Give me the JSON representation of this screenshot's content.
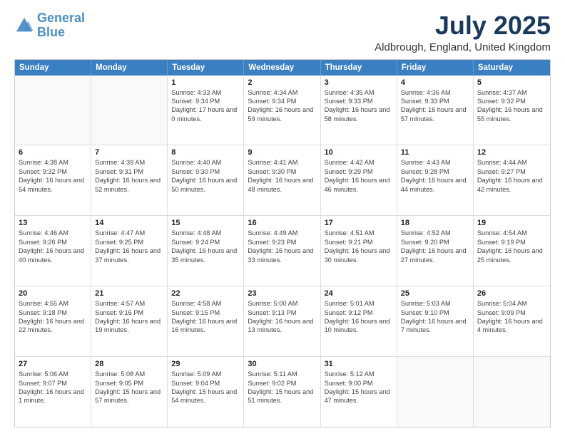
{
  "logo": {
    "line1": "General",
    "line2": "Blue"
  },
  "title": "July 2025",
  "subtitle": "Aldbrough, England, United Kingdom",
  "days_of_week": [
    "Sunday",
    "Monday",
    "Tuesday",
    "Wednesday",
    "Thursday",
    "Friday",
    "Saturday"
  ],
  "weeks": [
    [
      {
        "day": "",
        "sunrise": "",
        "sunset": "",
        "daylight": ""
      },
      {
        "day": "",
        "sunrise": "",
        "sunset": "",
        "daylight": ""
      },
      {
        "day": "1",
        "sunrise": "Sunrise: 4:33 AM",
        "sunset": "Sunset: 9:34 PM",
        "daylight": "Daylight: 17 hours and 0 minutes."
      },
      {
        "day": "2",
        "sunrise": "Sunrise: 4:34 AM",
        "sunset": "Sunset: 9:34 PM",
        "daylight": "Daylight: 16 hours and 59 minutes."
      },
      {
        "day": "3",
        "sunrise": "Sunrise: 4:35 AM",
        "sunset": "Sunset: 9:33 PM",
        "daylight": "Daylight: 16 hours and 58 minutes."
      },
      {
        "day": "4",
        "sunrise": "Sunrise: 4:36 AM",
        "sunset": "Sunset: 9:33 PM",
        "daylight": "Daylight: 16 hours and 57 minutes."
      },
      {
        "day": "5",
        "sunrise": "Sunrise: 4:37 AM",
        "sunset": "Sunset: 9:32 PM",
        "daylight": "Daylight: 16 hours and 55 minutes."
      }
    ],
    [
      {
        "day": "6",
        "sunrise": "Sunrise: 4:38 AM",
        "sunset": "Sunset: 9:32 PM",
        "daylight": "Daylight: 16 hours and 54 minutes."
      },
      {
        "day": "7",
        "sunrise": "Sunrise: 4:39 AM",
        "sunset": "Sunset: 9:31 PM",
        "daylight": "Daylight: 16 hours and 52 minutes."
      },
      {
        "day": "8",
        "sunrise": "Sunrise: 4:40 AM",
        "sunset": "Sunset: 9:30 PM",
        "daylight": "Daylight: 16 hours and 50 minutes."
      },
      {
        "day": "9",
        "sunrise": "Sunrise: 4:41 AM",
        "sunset": "Sunset: 9:30 PM",
        "daylight": "Daylight: 16 hours and 48 minutes."
      },
      {
        "day": "10",
        "sunrise": "Sunrise: 4:42 AM",
        "sunset": "Sunset: 9:29 PM",
        "daylight": "Daylight: 16 hours and 46 minutes."
      },
      {
        "day": "11",
        "sunrise": "Sunrise: 4:43 AM",
        "sunset": "Sunset: 9:28 PM",
        "daylight": "Daylight: 16 hours and 44 minutes."
      },
      {
        "day": "12",
        "sunrise": "Sunrise: 4:44 AM",
        "sunset": "Sunset: 9:27 PM",
        "daylight": "Daylight: 16 hours and 42 minutes."
      }
    ],
    [
      {
        "day": "13",
        "sunrise": "Sunrise: 4:46 AM",
        "sunset": "Sunset: 9:26 PM",
        "daylight": "Daylight: 16 hours and 40 minutes."
      },
      {
        "day": "14",
        "sunrise": "Sunrise: 4:47 AM",
        "sunset": "Sunset: 9:25 PM",
        "daylight": "Daylight: 16 hours and 37 minutes."
      },
      {
        "day": "15",
        "sunrise": "Sunrise: 4:48 AM",
        "sunset": "Sunset: 9:24 PM",
        "daylight": "Daylight: 16 hours and 35 minutes."
      },
      {
        "day": "16",
        "sunrise": "Sunrise: 4:49 AM",
        "sunset": "Sunset: 9:23 PM",
        "daylight": "Daylight: 16 hours and 33 minutes."
      },
      {
        "day": "17",
        "sunrise": "Sunrise: 4:51 AM",
        "sunset": "Sunset: 9:21 PM",
        "daylight": "Daylight: 16 hours and 30 minutes."
      },
      {
        "day": "18",
        "sunrise": "Sunrise: 4:52 AM",
        "sunset": "Sunset: 9:20 PM",
        "daylight": "Daylight: 16 hours and 27 minutes."
      },
      {
        "day": "19",
        "sunrise": "Sunrise: 4:54 AM",
        "sunset": "Sunset: 9:19 PM",
        "daylight": "Daylight: 16 hours and 25 minutes."
      }
    ],
    [
      {
        "day": "20",
        "sunrise": "Sunrise: 4:55 AM",
        "sunset": "Sunset: 9:18 PM",
        "daylight": "Daylight: 16 hours and 22 minutes."
      },
      {
        "day": "21",
        "sunrise": "Sunrise: 4:57 AM",
        "sunset": "Sunset: 9:16 PM",
        "daylight": "Daylight: 16 hours and 19 minutes."
      },
      {
        "day": "22",
        "sunrise": "Sunrise: 4:58 AM",
        "sunset": "Sunset: 9:15 PM",
        "daylight": "Daylight: 16 hours and 16 minutes."
      },
      {
        "day": "23",
        "sunrise": "Sunrise: 5:00 AM",
        "sunset": "Sunset: 9:13 PM",
        "daylight": "Daylight: 16 hours and 13 minutes."
      },
      {
        "day": "24",
        "sunrise": "Sunrise: 5:01 AM",
        "sunset": "Sunset: 9:12 PM",
        "daylight": "Daylight: 16 hours and 10 minutes."
      },
      {
        "day": "25",
        "sunrise": "Sunrise: 5:03 AM",
        "sunset": "Sunset: 9:10 PM",
        "daylight": "Daylight: 16 hours and 7 minutes."
      },
      {
        "day": "26",
        "sunrise": "Sunrise: 5:04 AM",
        "sunset": "Sunset: 9:09 PM",
        "daylight": "Daylight: 16 hours and 4 minutes."
      }
    ],
    [
      {
        "day": "27",
        "sunrise": "Sunrise: 5:06 AM",
        "sunset": "Sunset: 9:07 PM",
        "daylight": "Daylight: 16 hours and 1 minute."
      },
      {
        "day": "28",
        "sunrise": "Sunrise: 5:08 AM",
        "sunset": "Sunset: 9:05 PM",
        "daylight": "Daylight: 15 hours and 57 minutes."
      },
      {
        "day": "29",
        "sunrise": "Sunrise: 5:09 AM",
        "sunset": "Sunset: 9:04 PM",
        "daylight": "Daylight: 15 hours and 54 minutes."
      },
      {
        "day": "30",
        "sunrise": "Sunrise: 5:11 AM",
        "sunset": "Sunset: 9:02 PM",
        "daylight": "Daylight: 15 hours and 51 minutes."
      },
      {
        "day": "31",
        "sunrise": "Sunrise: 5:12 AM",
        "sunset": "Sunset: 9:00 PM",
        "daylight": "Daylight: 15 hours and 47 minutes."
      },
      {
        "day": "",
        "sunrise": "",
        "sunset": "",
        "daylight": ""
      },
      {
        "day": "",
        "sunrise": "",
        "sunset": "",
        "daylight": ""
      }
    ]
  ]
}
